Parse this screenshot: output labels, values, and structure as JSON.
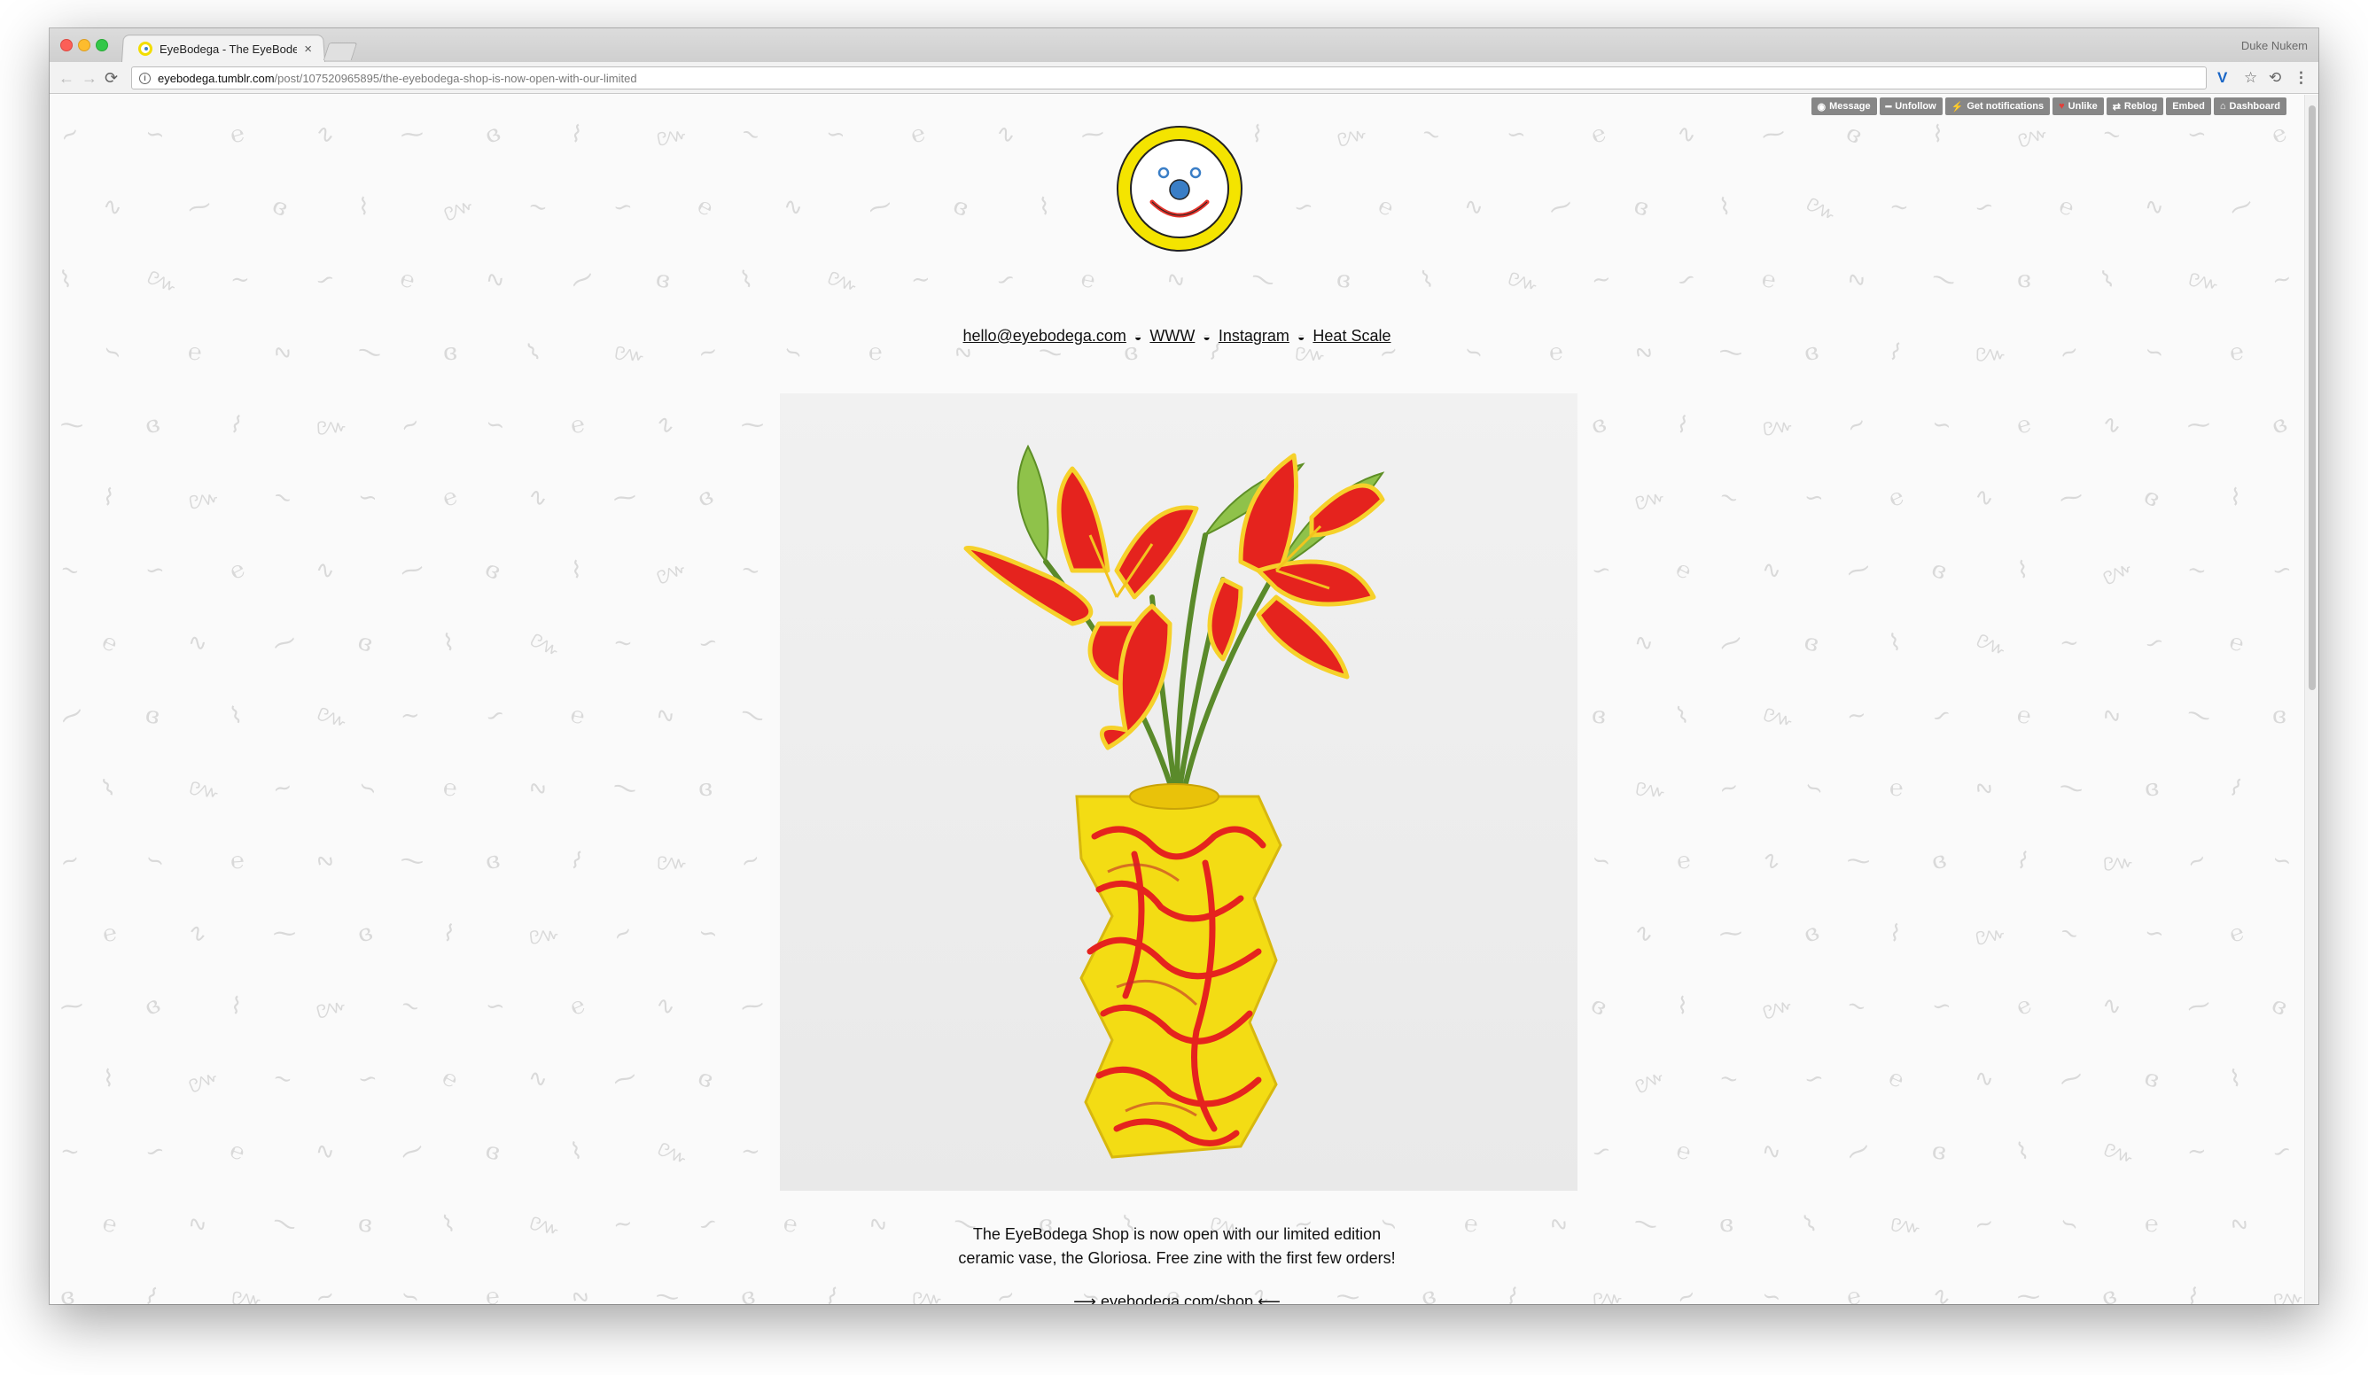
{
  "browser": {
    "tab_title": "EyeBodega - The EyeBodeg",
    "tab_close": "×",
    "profile_name": "Duke Nukem",
    "url_host": "eyebodega.tumblr.com",
    "url_path": "/post/107520965895/the-eyebodega-shop-is-now-open-with-our-limited",
    "back_icon": "←",
    "forward_icon": "→",
    "reload_icon": "⟳",
    "info_icon": "i",
    "vivino_icon": "V",
    "star_icon": "☆",
    "extension_icon": "⟲",
    "menu_icon": "⋮"
  },
  "tumblr_controls": [
    {
      "label": "Message",
      "icon": "◉"
    },
    {
      "label": "Unfollow",
      "icon": "━"
    },
    {
      "label": "Get notifications",
      "icon": "⚡"
    },
    {
      "label": "Unlike",
      "icon": "♥"
    },
    {
      "label": "Reblog",
      "icon": "⇄"
    },
    {
      "label": "Embed",
      "icon": ""
    },
    {
      "label": "Dashboard",
      "icon": "⌂"
    }
  ],
  "header": {
    "links": {
      "email": "hello@eyebodega.com",
      "www": "WWW",
      "instagram": "Instagram",
      "heat_scale": "Heat Scale"
    },
    "separator": "◒"
  },
  "post": {
    "caption_line1": "The EyeBodega Shop is now open with our limited edition",
    "caption_line2": "ceramic vase, the Gloriosa. Free zine with the first few orders!",
    "shop_arrow_left": "⟶",
    "shop_link": "eyebodega.com/shop",
    "shop_arrow_right": "⟵"
  },
  "colors": {
    "logo_yellow": "#f4e400",
    "logo_blue": "#3a7ec6",
    "logo_red": "#e3332b",
    "vase_yellow": "#f3dc14",
    "flower_red": "#e5231e"
  }
}
